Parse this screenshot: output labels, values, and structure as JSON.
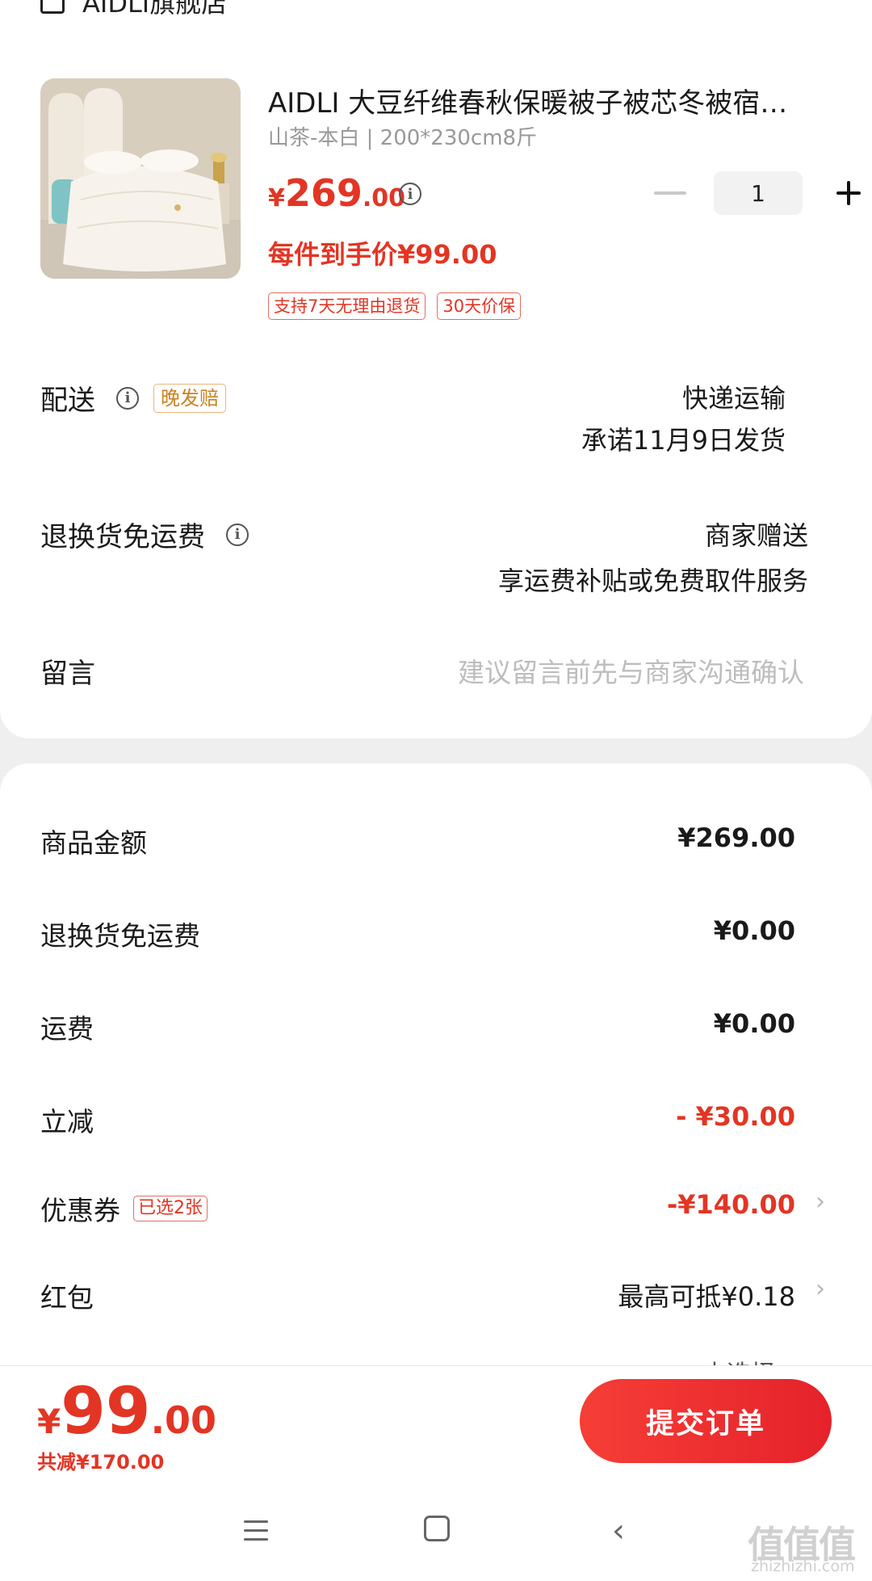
{
  "store": {
    "icon": "store-icon",
    "name": "AIDLI旗舰店"
  },
  "product": {
    "title": "AIDLI 大豆纤维春秋保暖被子被芯冬被宿…",
    "spec": "山茶-本白 | 200*230cm8斤",
    "price_symbol": "¥",
    "price_int": "269",
    "price_dec": ".00",
    "final_price": "每件到手价¥99.00",
    "tags": [
      "支持7天无理由退货",
      "30天价保"
    ],
    "quantity": "1"
  },
  "delivery": {
    "label": "配送",
    "late_tag": "晚发赔",
    "method": "快递运输",
    "promise": "承诺11月9日发货"
  },
  "return_shipping": {
    "label": "退换货免运费",
    "value": "商家赠送",
    "desc": "享运费补贴或免费取件服务"
  },
  "message": {
    "label": "留言",
    "placeholder": "建议留言前先与商家沟通确认"
  },
  "summary": {
    "goods_amount_label": "商品金额",
    "goods_amount": "¥269.00",
    "return_free_label": "退换货免运费",
    "return_free": "¥0.00",
    "shipping_label": "运费",
    "shipping": "¥0.00",
    "instant_discount_label": "立减",
    "instant_discount": "- ¥30.00",
    "coupon_label": "优惠券",
    "coupon_tag": "已选2张",
    "coupon": "-¥140.00",
    "red_packet_label": "红包",
    "red_packet": "最高可抵¥0.18",
    "cut_off_text": "未选择"
  },
  "footer": {
    "price_symbol": "¥",
    "price_int": "99",
    "price_dec": ".00",
    "saved": "共减¥170.00",
    "submit": "提交订单"
  },
  "nav": {
    "menu": "menu-icon",
    "home": "home-icon",
    "back": "back-icon"
  },
  "watermark": {
    "logo": "值值值",
    "url": "zhizhizhi.com"
  },
  "colors": {
    "accent": "#e33524",
    "button": "#f63e37",
    "late_tag": "#c98220"
  }
}
